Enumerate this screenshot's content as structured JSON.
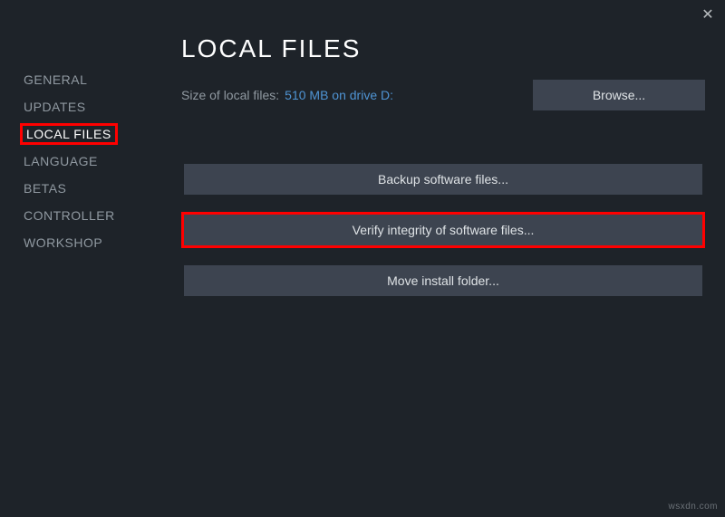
{
  "close_icon": "✕",
  "sidebar": {
    "items": [
      {
        "label": "GENERAL"
      },
      {
        "label": "UPDATES"
      },
      {
        "label": "LOCAL FILES"
      },
      {
        "label": "LANGUAGE"
      },
      {
        "label": "BETAS"
      },
      {
        "label": "CONTROLLER"
      },
      {
        "label": "WORKSHOP"
      }
    ]
  },
  "main": {
    "title": "LOCAL FILES",
    "size_label": "Size of local files:",
    "size_value": "510 MB on drive D:",
    "browse_label": "Browse...",
    "buttons": [
      {
        "label": "Backup software files..."
      },
      {
        "label": "Verify integrity of software files..."
      },
      {
        "label": "Move install folder..."
      }
    ]
  },
  "watermark": "wsxdn.com"
}
